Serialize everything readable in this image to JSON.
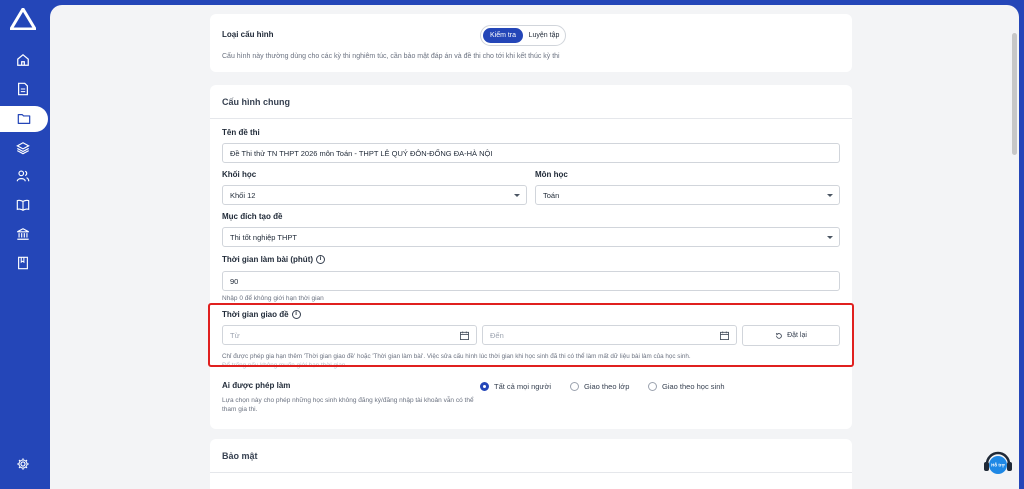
{
  "sidebar": {
    "items": [
      {
        "icon": "home-icon"
      },
      {
        "icon": "document-icon"
      },
      {
        "icon": "folder-icon"
      },
      {
        "icon": "layers-icon"
      },
      {
        "icon": "users-icon"
      },
      {
        "icon": "book-open-icon"
      },
      {
        "icon": "bank-icon"
      },
      {
        "icon": "notebook-icon"
      }
    ],
    "settings_icon": "gear-icon"
  },
  "config_type": {
    "label": "Loại cấu hình",
    "options": [
      "Kiểm tra",
      "Luyện tập"
    ],
    "selected": "Kiểm tra",
    "hint": "Cấu hình này thường dùng cho các kỳ thi nghiêm túc, cần bảo mật đáp án và đề thi cho tới khi kết thúc kỳ thi"
  },
  "general": {
    "title": "Cấu hình chung",
    "exam_name_label": "Tên đề thi",
    "exam_name_value": "Đề Thi thử TN THPT 2026 môn Toán - THPT LÊ QUÝ ĐÔN-ĐỐNG ĐA-HÀ NỘI",
    "grade_label": "Khối học",
    "grade_value": "Khối 12",
    "subject_label": "Môn học",
    "subject_value": "Toán",
    "purpose_label": "Mục đích tạo đề",
    "purpose_value": "Thi tốt nghiệp THPT",
    "duration_label": "Thời gian làm bài (phút)",
    "duration_value": "90",
    "duration_hint": "Nhập 0 để không giới hạn thời gian",
    "assign_label": "Thời gian giao đề",
    "from_placeholder": "Từ",
    "to_placeholder": "Đến",
    "reset_label": "Đặt lại",
    "assign_hint": "Chỉ được phép gia hạn thêm 'Thời gian giao đề' hoặc 'Thời gian làm bài'. Việc sửa cấu hình lúc thời gian khi học sinh đã thi có thể làm mất dữ liệu bài làm của học sinh.",
    "assign_hint2": "Để trống nếu không muốn giới hạn thời gian",
    "who_label": "Ai được phép làm",
    "who_hint_line1": "Lựa chọn này cho phép những học sinh không đăng ký/đăng nhập tài khoản vẫn có thể",
    "who_hint_line2": "tham gia thi.",
    "who_options": [
      "Tất cả mọi người",
      "Giao theo lớp",
      "Giao theo học sinh"
    ],
    "who_selected": "Tất cả mọi người"
  },
  "security": {
    "title": "Bảo mật"
  },
  "support": {
    "label": "Hỗ trợ"
  },
  "colors": {
    "brand": "#2446b8",
    "highlight": "#e0201f"
  }
}
